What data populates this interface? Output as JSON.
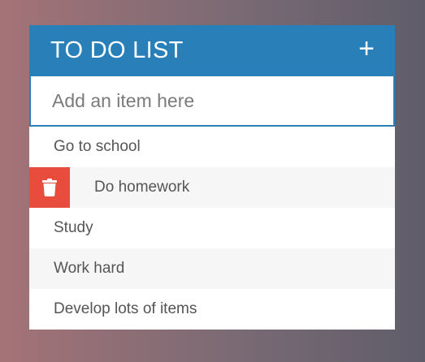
{
  "header": {
    "title": "TO DO LIST",
    "add_icon": "plus-icon",
    "add_glyph": "+"
  },
  "input": {
    "placeholder": "Add an item here",
    "value": ""
  },
  "items": [
    {
      "label": "Go to school",
      "show_delete": false
    },
    {
      "label": "Do homework",
      "show_delete": true
    },
    {
      "label": "Study",
      "show_delete": false
    },
    {
      "label": "Work hard",
      "show_delete": false
    },
    {
      "label": "Develop lots of items",
      "show_delete": false
    }
  ],
  "colors": {
    "header": "#2980b9",
    "delete": "#e74c3c"
  }
}
